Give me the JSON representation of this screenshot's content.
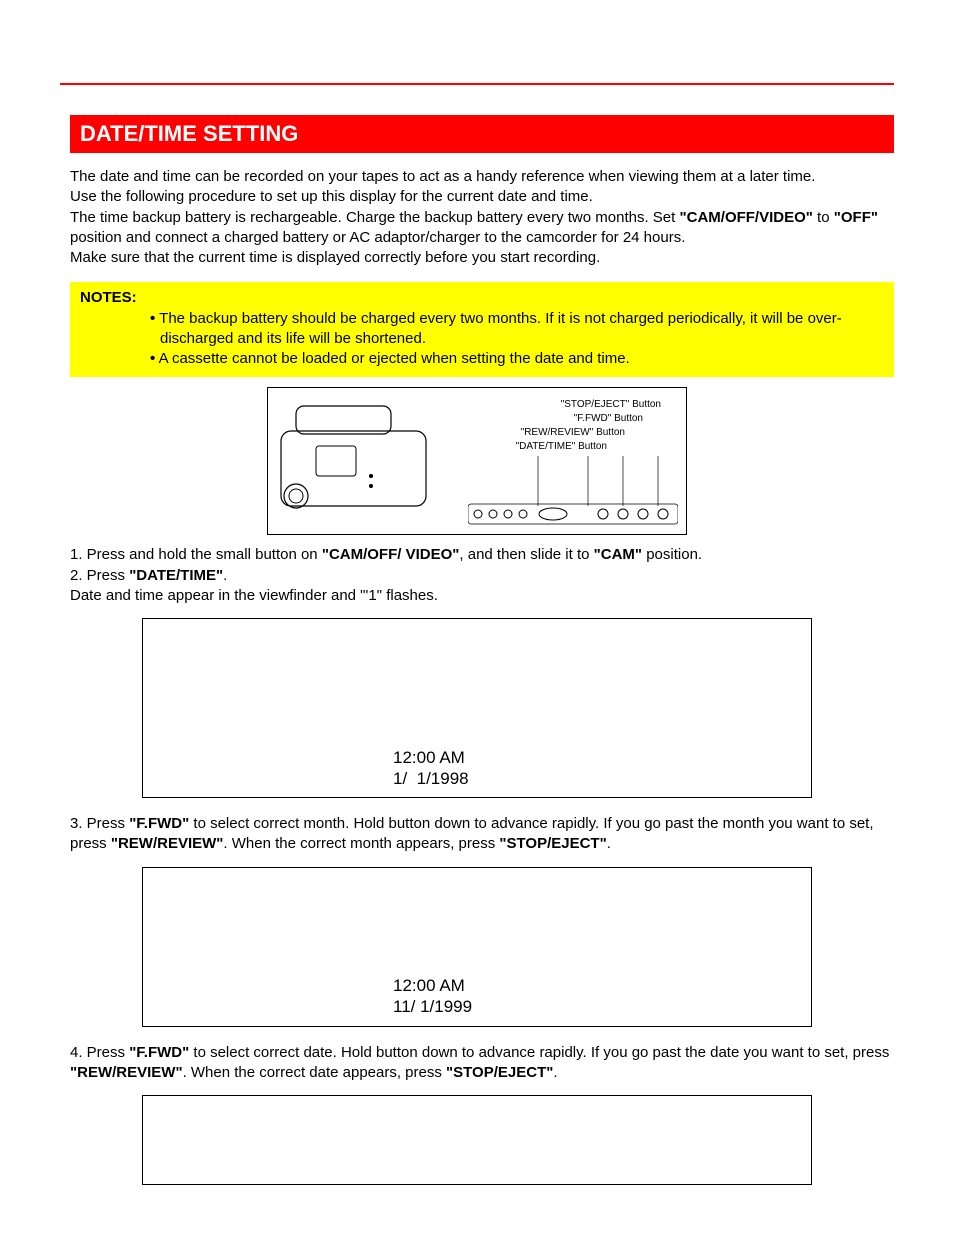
{
  "header": {
    "title": "DATE/TIME SETTING"
  },
  "intro": {
    "p1": "The date and time can be recorded on your tapes to act as a handy reference when viewing them at a later time.",
    "p2": "Use the following procedure to set up this display for the current date and time.",
    "p3a": "The time backup battery is rechargeable. Charge the backup battery every two months. Set ",
    "p3b": "\"CAM/OFF/VIDEO\"",
    "p3c": " to ",
    "p3d": "\"OFF\"",
    "p3e": " position and connect a charged battery or AC adaptor/charger to the camcorder for 24 hours.",
    "p4": "Make sure that the current time is displayed correctly before you start recording."
  },
  "notes": {
    "title": "NOTES:",
    "items": [
      "The backup battery should be charged every two months. If it is not charged periodically, it will be over-discharged and its life will be shortened.",
      "A cassette cannot be loaded or ejected when setting the date and time."
    ]
  },
  "diagram": {
    "labels": {
      "stop_eject": "\"STOP/EJECT\" Button",
      "ffwd": "\"F.FWD\" Button",
      "rew_review": "\"REW/REVIEW\" Button",
      "date_time": "\"DATE/TIME\" Button"
    }
  },
  "step1": {
    "prefix": "1. Press and hold the small button on ",
    "b1": "\"CAM/OFF/ VIDEO\"",
    "mid": ", and then slide it to ",
    "b2": "\"CAM\"",
    "suffix": " position."
  },
  "step2": {
    "prefix": "2. Press ",
    "b1": "\"DATE/TIME\"",
    "suffix": ".",
    "line2": "Date and time appear in the viewfinder and \"'1\" flashes."
  },
  "viewfinder1": {
    "time": "12:00 AM",
    "date": "1/  1/1998"
  },
  "step3": {
    "prefix": "3. Press ",
    "b1": "\"F.FWD\"",
    "mid1": " to select correct month. Hold button down to advance rapidly. If you go past the month you want to set, press ",
    "b2": "\"REW/REVIEW\"",
    "mid2": ". When the correct month appears, press ",
    "b3": "\"STOP/EJECT\"",
    "suffix": "."
  },
  "viewfinder2": {
    "time": "12:00 AM",
    "date": "11/ 1/1999"
  },
  "step4": {
    "prefix": "4. Press ",
    "b1": "\"F.FWD\"",
    "mid1": " to select correct date. Hold button down to advance rapidly. If you go past the date you want to set, press ",
    "b2": "\"REW/REVIEW\"",
    "mid2": ". When the correct date appears, press ",
    "b3": "\"STOP/EJECT\"",
    "suffix": "."
  }
}
